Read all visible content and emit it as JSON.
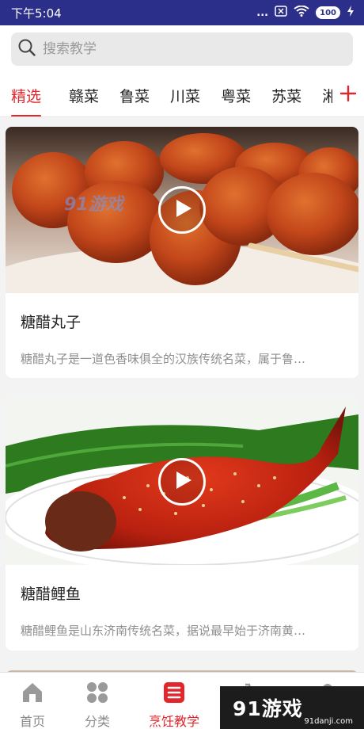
{
  "status_bar": {
    "time": "下午5:04",
    "dots": "...",
    "battery": "100",
    "icons": [
      "sim-off-icon",
      "wifi-icon",
      "battery-icon",
      "charging-icon"
    ]
  },
  "search": {
    "placeholder": "搜索教学"
  },
  "tabs": {
    "items": [
      {
        "label": "精选",
        "active": true
      },
      {
        "label": "赣菜",
        "active": false
      },
      {
        "label": "鲁菜",
        "active": false
      },
      {
        "label": "川菜",
        "active": false
      },
      {
        "label": "粤菜",
        "active": false
      },
      {
        "label": "苏菜",
        "active": false
      },
      {
        "label": "湘",
        "active": false
      }
    ],
    "add_icon": "plus-icon"
  },
  "feed": {
    "cards": [
      {
        "title": "糖醋丸子",
        "desc": "糖醋丸子是一道色香味俱全的汉族传统名菜，属于鲁…",
        "watermark": "91游戏"
      },
      {
        "title": "糖醋鲤鱼",
        "desc": "糖醋鲤鱼是山东济南传统名菜，据说最早始于济南黄…"
      }
    ]
  },
  "bottom_nav": {
    "items": [
      {
        "label": "首页",
        "icon": "home-icon",
        "active": false
      },
      {
        "label": "分类",
        "icon": "category-icon",
        "active": false
      },
      {
        "label": "烹饪教学",
        "icon": "cooking-lesson-icon",
        "active": true
      }
    ]
  },
  "brand": {
    "text": "91游戏",
    "sub": "91danji.com"
  },
  "colors": {
    "accent": "#e2262b",
    "status_bar": "#2b2f8a"
  }
}
